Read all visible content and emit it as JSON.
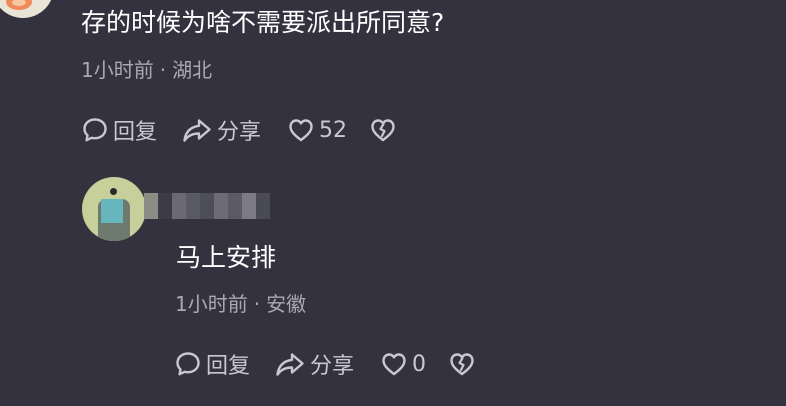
{
  "comment": {
    "text": "存的时候为啥不需要派出所同意?",
    "time": "1小时前",
    "location": "湖北",
    "reply_label": "回复",
    "share_label": "分享",
    "like_count": "52"
  },
  "reply": {
    "text": "马上安排",
    "time": "1小时前",
    "location": "安徽",
    "reply_label": "回复",
    "share_label": "分享",
    "like_count": "0"
  },
  "separator": "·",
  "icons": {
    "reply": "comment-bubble-icon",
    "share": "share-arrow-icon",
    "like": "heart-icon",
    "dislike": "broken-heart-icon"
  },
  "colors": {
    "background": "#33323e",
    "text_primary": "#ffffff",
    "text_secondary": "#a9a8b3",
    "action": "#c9c8d0"
  }
}
